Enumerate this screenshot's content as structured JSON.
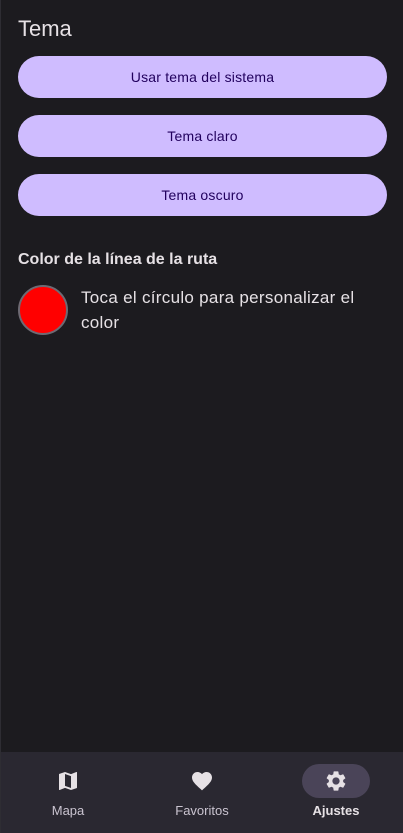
{
  "theme": {
    "title": "Tema",
    "buttons": [
      {
        "label": "Usar tema del sistema"
      },
      {
        "label": "Tema claro"
      },
      {
        "label": "Tema oscuro"
      }
    ]
  },
  "route_color": {
    "title": "Color de la línea de la ruta",
    "hint": "Toca el círculo para personalizar el color",
    "current_color": "#ff0000"
  },
  "nav": {
    "items": [
      {
        "label": "Mapa",
        "icon": "map-icon"
      },
      {
        "label": "Favoritos",
        "icon": "heart-icon"
      },
      {
        "label": "Ajustes",
        "icon": "gear-icon",
        "active": true
      }
    ]
  },
  "colors": {
    "background": "#1c1b1f",
    "button_bg": "#cfbcff",
    "button_text": "#21005d",
    "navbar_bg": "#2a2831",
    "active_pill": "#4a4458"
  }
}
